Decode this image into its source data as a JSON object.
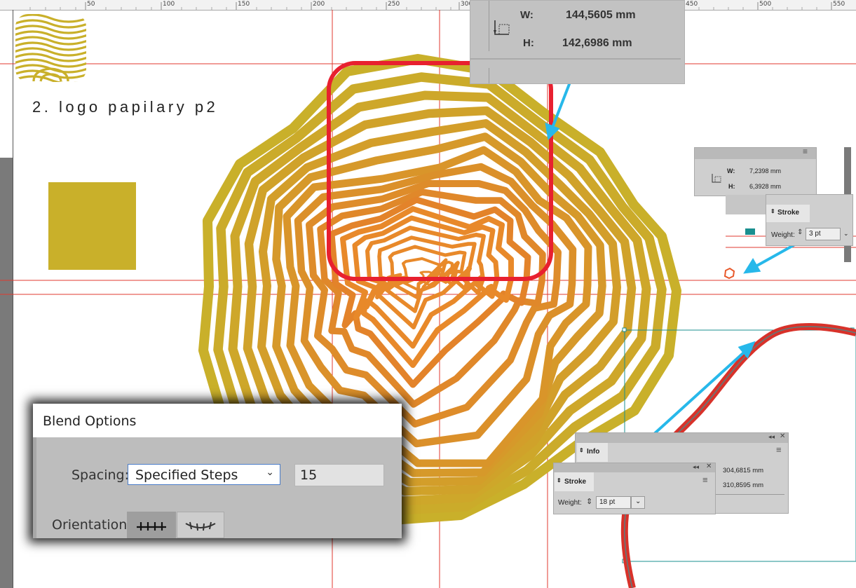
{
  "ruler": {
    "ticks": [
      "50",
      "100",
      "150",
      "200",
      "250",
      "300",
      "450",
      "500",
      "550"
    ]
  },
  "document": {
    "title": "2. logo papilary p2"
  },
  "callout_dimensions": {
    "w_label": "W:",
    "w_value": "144,5605 mm",
    "h_label": "H:",
    "h_value": "142,6986 mm"
  },
  "transform_small": {
    "w_label": "W:",
    "w_value": "7,2398 mm",
    "h_label": "H:",
    "h_value": "6,3928 mm"
  },
  "stroke_small": {
    "tab": "Stroke",
    "weight_label": "Weight:",
    "weight_value": "3 pt"
  },
  "info_panel": {
    "tab": "Info",
    "w_value": "304,6815 mm",
    "h_value": "310,8595 mm"
  },
  "stroke_large": {
    "tab": "Stroke",
    "weight_label": "Weight:",
    "weight_value": "18 pt"
  },
  "blend_options": {
    "title": "Blend Options",
    "spacing_label": "Spacing:",
    "spacing_value": "Specified Steps",
    "steps_value": "15",
    "orientation_label": "Orientation:"
  },
  "colors": {
    "logo_gold": "#c9b02a",
    "ring_orange": "#e8892a",
    "guide_red": "#e0392f",
    "highlight_red": "#e8202f",
    "arrow_cyan": "#27b8ea",
    "teal_selection": "#1a8f8f"
  },
  "icons": [
    "dimension-icon",
    "chevron-down-icon",
    "stepper-icon",
    "panel-menu-icon",
    "close-icon",
    "collapse-icon",
    "orientation-align-page-icon",
    "orientation-align-path-icon"
  ]
}
